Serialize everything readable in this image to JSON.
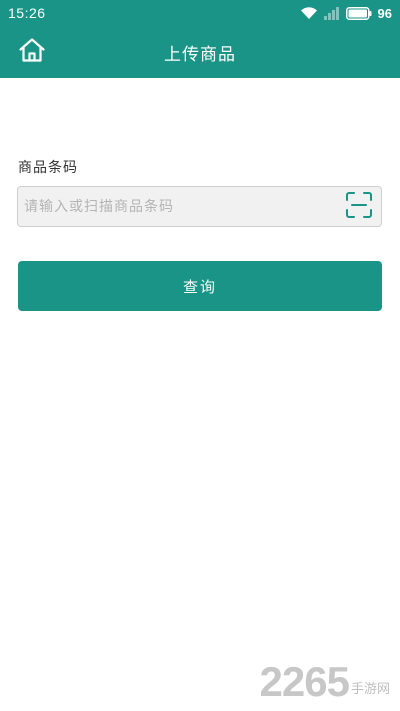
{
  "status_bar": {
    "time": "15:26",
    "battery_level": "96",
    "icons": [
      "wifi-icon",
      "signal-icon",
      "battery-icon"
    ]
  },
  "header": {
    "title": "上传商品",
    "home_icon": "home-icon"
  },
  "form": {
    "barcode_label": "商品条码",
    "barcode_value": "",
    "barcode_placeholder": "请输入或扫描商品条码",
    "scan_icon": "scan-icon",
    "query_button_label": "查询"
  },
  "watermark": {
    "number": "2265",
    "text": "手游网"
  },
  "colors": {
    "primary": "#1a9486",
    "background": "#ffffff",
    "input_background": "#f1f1f1",
    "placeholder": "#b4b4b4"
  }
}
